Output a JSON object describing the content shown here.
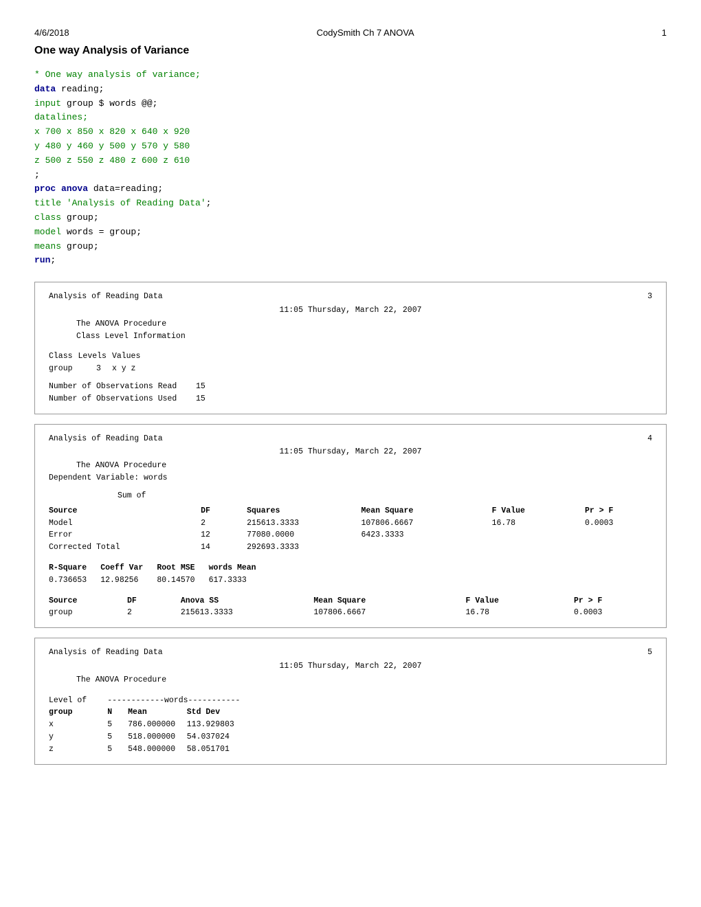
{
  "header": {
    "date": "4/6/2018",
    "title": "CodySmith Ch 7 ANOVA",
    "page": "1"
  },
  "page_heading": "One way Analysis of Variance",
  "code": {
    "lines": [
      {
        "type": "comment",
        "text": "* One way analysis of variance;"
      },
      {
        "type": "mixed",
        "parts": [
          {
            "style": "keyword-bold",
            "text": "data"
          },
          {
            "style": "normal",
            "text": " reading;"
          }
        ]
      },
      {
        "type": "mixed",
        "parts": [
          {
            "style": "keyword",
            "text": "input"
          },
          {
            "style": "normal",
            "text": " group $ words @@;"
          }
        ]
      },
      {
        "type": "keyword",
        "text": "datalines;"
      },
      {
        "type": "data",
        "text": "x 700 x 850 x 820 x 640 x 920"
      },
      {
        "type": "data",
        "text": "y 480 y 460 y 500 y 570 y 580"
      },
      {
        "type": "data",
        "text": "z 500 z 550 z 480 z 600 z 610"
      },
      {
        "type": "normal",
        "text": ";"
      },
      {
        "type": "mixed",
        "parts": [
          {
            "style": "keyword-bold",
            "text": "proc anova"
          },
          {
            "style": "normal",
            "text": " data=reading;"
          }
        ]
      },
      {
        "type": "mixed",
        "parts": [
          {
            "style": "keyword",
            "text": " title"
          },
          {
            "style": "normal",
            "text": " "
          },
          {
            "style": "string",
            "text": "'Analysis of Reading Data'"
          },
          {
            "style": "normal",
            "text": ";"
          }
        ]
      },
      {
        "type": "mixed",
        "parts": [
          {
            "style": "keyword",
            "text": " class"
          },
          {
            "style": "normal",
            "text": " group;"
          }
        ]
      },
      {
        "type": "mixed",
        "parts": [
          {
            "style": "keyword",
            "text": " model"
          },
          {
            "style": "normal",
            "text": " words = group;"
          }
        ]
      },
      {
        "type": "mixed",
        "parts": [
          {
            "style": "keyword",
            "text": " means"
          },
          {
            "style": "normal",
            "text": " group;"
          }
        ]
      },
      {
        "type": "mixed",
        "parts": [
          {
            "style": "keyword-bold",
            "text": "run"
          },
          {
            "style": "normal",
            "text": ";"
          }
        ]
      }
    ]
  },
  "output_box1": {
    "title": "Analysis of Reading Data",
    "page": "3",
    "time": "11:05 Thursday, March 22, 2007",
    "procedure": "The ANOVA Procedure",
    "section": "Class Level Information",
    "table": {
      "headers": [
        "Class",
        "Levels",
        "Values"
      ],
      "rows": [
        [
          "group",
          "3",
          "x y z"
        ]
      ]
    },
    "obs_read_label": "Number of Observations Read",
    "obs_read_value": "15",
    "obs_used_label": "Number of Observations Used",
    "obs_used_value": "15"
  },
  "output_box2": {
    "title": "Analysis of Reading Data",
    "page": "4",
    "time": "11:05 Thursday, March 22, 2007",
    "procedure": "The ANOVA Procedure",
    "dep_var_label": "Dependent Variable: words",
    "sum_of": "Sum of",
    "table1_headers": [
      "Source",
      "DF",
      "Squares",
      "Mean Square",
      "F Value",
      "Pr > F"
    ],
    "table1_rows": [
      [
        "Model",
        "2",
        "215613.3333",
        "107806.6667",
        "16.78",
        "0.0003"
      ],
      [
        "Error",
        "12",
        "77080.0000",
        "6423.3333",
        "",
        ""
      ],
      [
        "Corrected Total",
        "14",
        "292693.3333",
        "",
        "",
        ""
      ]
    ],
    "table2_headers": [
      "R-Square",
      "Coeff Var",
      "Root MSE",
      "words Mean"
    ],
    "table2_rows": [
      [
        "0.736653",
        "12.98256",
        "80.14570",
        "617.3333"
      ]
    ],
    "table3_headers": [
      "Source",
      "DF",
      "Anova SS",
      "Mean Square",
      "F Value",
      "Pr > F"
    ],
    "table3_rows": [
      [
        "group",
        "2",
        "215613.3333",
        "107806.6667",
        "16.78",
        "0.0003"
      ]
    ]
  },
  "output_box3": {
    "title": "Analysis of Reading Data",
    "page": "5",
    "time": "11:05 Thursday, March 22, 2007",
    "procedure": "The ANOVA Procedure",
    "level_label": "Level of",
    "words_dashes": "------------words-----------",
    "table_headers": [
      "group",
      "N",
      "Mean",
      "Std Dev"
    ],
    "table_rows": [
      [
        "x",
        "5",
        "786.000000",
        "113.929803"
      ],
      [
        "y",
        "5",
        "518.000000",
        "54.037024"
      ],
      [
        "z",
        "5",
        "548.000000",
        "58.051701"
      ]
    ]
  }
}
